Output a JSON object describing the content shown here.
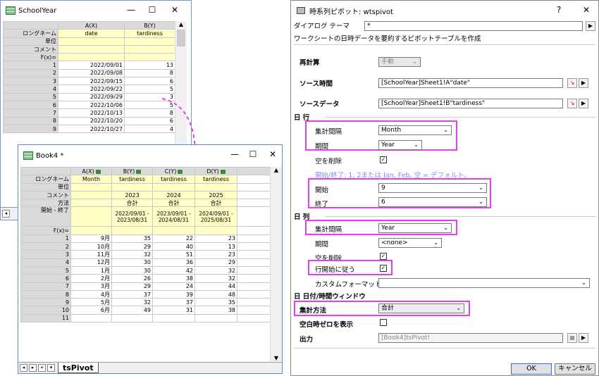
{
  "schoolyear": {
    "title": "SchoolYear",
    "cols": [
      "A(X)",
      "B(Y)"
    ],
    "header_rows": [
      {
        "label": "ロングネーム",
        "a": "date",
        "b": "tardiness"
      },
      {
        "label": "単位",
        "a": "",
        "b": ""
      },
      {
        "label": "コメント",
        "a": "",
        "b": ""
      },
      {
        "label": "F(x)=",
        "a": "",
        "b": ""
      }
    ],
    "rows": [
      {
        "n": "1",
        "date": "2022/09/01",
        "val": "13"
      },
      {
        "n": "2",
        "date": "2022/09/08",
        "val": "8"
      },
      {
        "n": "3",
        "date": "2022/09/15",
        "val": "6"
      },
      {
        "n": "4",
        "date": "2022/09/22",
        "val": "5"
      },
      {
        "n": "5",
        "date": "2022/09/29",
        "val": "3"
      },
      {
        "n": "6",
        "date": "2022/10/06",
        "val": "5"
      },
      {
        "n": "7",
        "date": "2022/10/13",
        "val": "8"
      },
      {
        "n": "8",
        "date": "2022/10/20",
        "val": "6"
      },
      {
        "n": "9",
        "date": "2022/10/27",
        "val": "4"
      }
    ]
  },
  "book4": {
    "title": "Book4 *",
    "cols": [
      "A(X)",
      "B(Y)",
      "C(Y)",
      "D(Y)"
    ],
    "longname": {
      "label": "ロングネーム",
      "vals": [
        "Month",
        "tardiness",
        "tardiness",
        "tardiness"
      ]
    },
    "unit_label": "単位",
    "comment": {
      "label": "コメント",
      "vals": [
        "",
        "2023",
        "2024",
        "2025"
      ]
    },
    "method": {
      "label": "方法",
      "vals": [
        "",
        "合計",
        "合計",
        "合計"
      ]
    },
    "range": {
      "label": "開始 - 終了",
      "vals": [
        "",
        "2022/09/01 - 2023/08/31",
        "2023/09/01 - 2024/08/31",
        "2024/09/01 - 2025/08/31"
      ]
    },
    "fx_label": "F(x)=",
    "rows": [
      {
        "n": "1",
        "m": "9月",
        "b": "35",
        "c": "22",
        "d": "23"
      },
      {
        "n": "2",
        "m": "10月",
        "b": "29",
        "c": "40",
        "d": "13"
      },
      {
        "n": "3",
        "m": "11月",
        "b": "32",
        "c": "51",
        "d": "23"
      },
      {
        "n": "4",
        "m": "12月",
        "b": "30",
        "c": "36",
        "d": "29"
      },
      {
        "n": "5",
        "m": "1月",
        "b": "30",
        "c": "42",
        "d": "32"
      },
      {
        "n": "6",
        "m": "2月",
        "b": "26",
        "c": "38",
        "d": "32"
      },
      {
        "n": "7",
        "m": "3月",
        "b": "29",
        "c": "24",
        "d": "44"
      },
      {
        "n": "8",
        "m": "4月",
        "b": "37",
        "c": "39",
        "d": "48"
      },
      {
        "n": "9",
        "m": "5月",
        "b": "32",
        "c": "37",
        "d": "35"
      },
      {
        "n": "10",
        "m": "6月",
        "b": "49",
        "c": "31",
        "d": "38"
      },
      {
        "n": "11",
        "m": "",
        "b": "",
        "c": "",
        "d": ""
      }
    ],
    "sheet_tab": "tsPivot"
  },
  "dialog": {
    "title": "時系列ピボット: wtspivot",
    "help": "?",
    "close": "✕",
    "theme_label": "ダイアログ テーマ",
    "theme_value": "*",
    "description": "ワークシートの日時データを要約するピボットテーブルを作成",
    "recalc_label": "再計算",
    "recalc_value": "手動",
    "source_time_label": "ソース時間",
    "source_time_value": "[SchoolYear]Sheet1!A\"date\"",
    "source_data_label": "ソースデータ",
    "source_data_value": "[SchoolYear]Sheet1!B\"tardiness\"",
    "row_section": "日 行",
    "row_interval_label": "集計間隔",
    "row_interval_value": "Month",
    "row_period_label": "期間",
    "row_period_value": "Year",
    "row_empty_label": "空を削除",
    "hint": "開始/終了: 1, 2または Jan, Feb, 空 = デフォルト。",
    "start_label": "開始",
    "start_value": "9",
    "end_label": "終了",
    "end_value": "6",
    "col_section": "日 列",
    "col_interval_label": "集計間隔",
    "col_interval_value": "Year",
    "col_period_label": "期間",
    "col_period_value": "<none>",
    "col_empty_label": "空を削除",
    "follow_row_label": "行開始に従う",
    "custom_format_label": "カスタムフォーマット",
    "datetime_window": "日 日付/時間ウィンドウ",
    "agg_label": "集計方法",
    "agg_value": "合計",
    "zero_label": "空白時ゼロを表示",
    "output_label": "出力",
    "output_value": "[Book4]tsPivot!",
    "ok": "OK",
    "cancel": "キャンセル"
  }
}
